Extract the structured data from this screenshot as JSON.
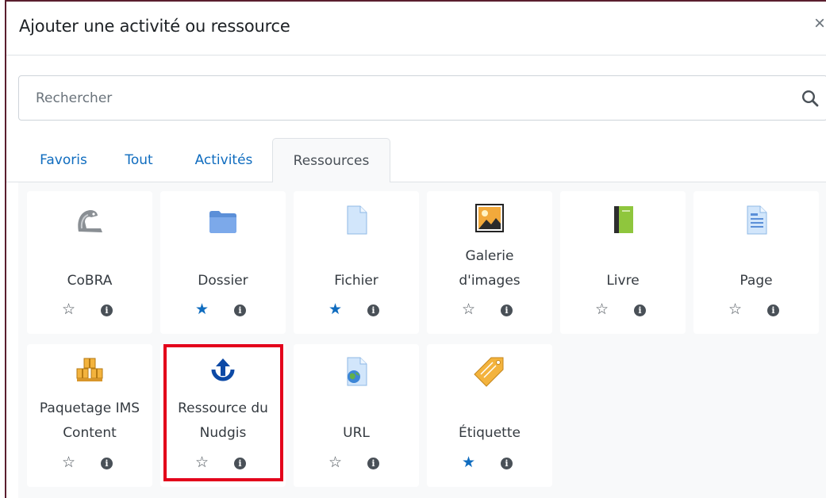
{
  "modal": {
    "title": "Ajouter une activité ou ressource",
    "close_glyph": "×"
  },
  "search": {
    "placeholder": "Rechercher",
    "icon": "search-icon"
  },
  "tabs": [
    {
      "label": "Favoris",
      "active": false
    },
    {
      "label": "Tout",
      "active": false
    },
    {
      "label": "Activités",
      "active": false
    },
    {
      "label": "Ressources",
      "active": true
    }
  ],
  "cards": [
    {
      "label_line1": "CoBRA",
      "label_line2": "",
      "icon": "cobra-icon",
      "starred": false
    },
    {
      "label_line1": "Dossier",
      "label_line2": "",
      "icon": "folder-icon",
      "starred": true
    },
    {
      "label_line1": "Fichier",
      "label_line2": "",
      "icon": "file-icon",
      "starred": true
    },
    {
      "label_line1": "Galerie",
      "label_line2": "d'images",
      "icon": "image-gallery-icon",
      "starred": false
    },
    {
      "label_line1": "Livre",
      "label_line2": "",
      "icon": "book-icon",
      "starred": false
    },
    {
      "label_line1": "Page",
      "label_line2": "",
      "icon": "page-icon",
      "starred": false
    },
    {
      "label_line1": "Paquetage IMS",
      "label_line2": "Content",
      "icon": "ims-package-icon",
      "starred": false
    },
    {
      "label_line1": "Ressource du",
      "label_line2": "Nudgis",
      "icon": "nudgis-upload-icon",
      "starred": false
    },
    {
      "label_line1": "URL",
      "label_line2": "",
      "icon": "url-icon",
      "starred": false
    },
    {
      "label_line1": "Étiquette",
      "label_line2": "",
      "icon": "label-tag-icon",
      "starred": true
    }
  ],
  "glyphs": {
    "star_off": "☆",
    "star_on": "★",
    "info": "i"
  },
  "colors": {
    "accent": "#0f6cbf",
    "highlight": "#e3001b",
    "frame": "#5a1e2e"
  }
}
